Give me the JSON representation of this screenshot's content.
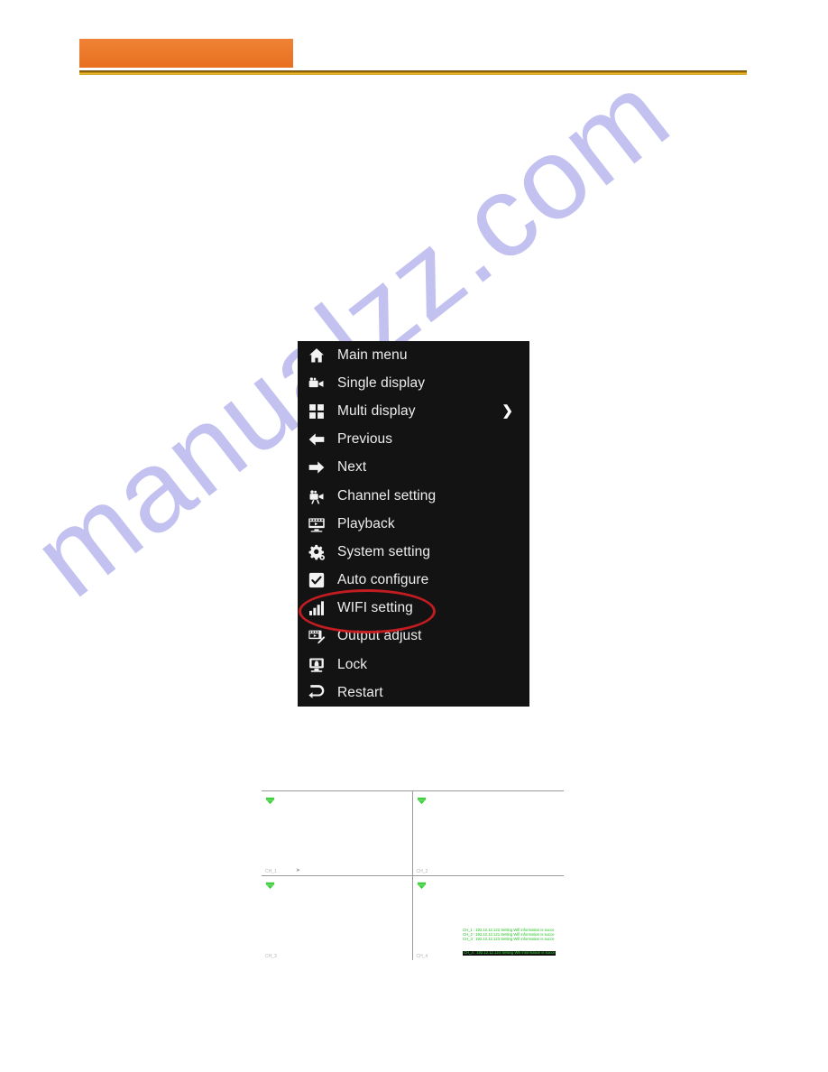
{
  "header": {
    "orange_band_color": "#ec7a2c",
    "rule_color": "#d9a114"
  },
  "watermark": {
    "text": "manualzz.com",
    "color": "#c3c1ef"
  },
  "context_menu": {
    "background_color": "#131313",
    "text_color": "#ededed",
    "items": [
      {
        "label": "Main menu",
        "icon": "home-icon",
        "submenu": false
      },
      {
        "label": "Single display",
        "icon": "video-camera-icon",
        "submenu": false
      },
      {
        "label": "Multi display",
        "icon": "grid-four-icon",
        "submenu": true,
        "arrow": "❯"
      },
      {
        "label": "Previous",
        "icon": "arrow-left-icon",
        "submenu": false
      },
      {
        "label": "Next",
        "icon": "arrow-right-icon",
        "submenu": false
      },
      {
        "label": "Channel setting",
        "icon": "camera-stand-icon",
        "submenu": false
      },
      {
        "label": "Playback",
        "icon": "film-playback-icon",
        "submenu": false
      },
      {
        "label": "System setting",
        "icon": "gears-icon",
        "submenu": false
      },
      {
        "label": "Auto configure",
        "icon": "checkbox-checked-icon",
        "submenu": false
      },
      {
        "label": "WIFI setting",
        "icon": "signal-bars-icon",
        "submenu": false,
        "highlighted": true
      },
      {
        "label": "Output adjust",
        "icon": "film-edit-icon",
        "submenu": false
      },
      {
        "label": "Lock",
        "icon": "monitor-lock-icon",
        "submenu": false
      },
      {
        "label": "Restart",
        "icon": "restart-arrow-icon",
        "submenu": false
      }
    ],
    "highlight": {
      "shape": "ellipse",
      "color": "#d01d22",
      "target_label": "WIFI setting"
    }
  },
  "dvr_screenshot": {
    "layout": "2x2",
    "panes": [
      {
        "label": "CH_1",
        "recording": true
      },
      {
        "label": "CH_2",
        "recording": true
      },
      {
        "label": "CH_3",
        "recording": true
      },
      {
        "label": "CH_4",
        "recording": true
      }
    ],
    "record_indicator_color": "#3fcf3f",
    "log_text_color": "#27c427",
    "log_lines": [
      {
        "text": "CH_1 : 192.12.12.122 Setting Wifi information is succe",
        "highlighted": false
      },
      {
        "text": "CH_2 : 192.12.12.121 Setting Wifi information is succe",
        "highlighted": false
      },
      {
        "text": "CH_3 : 192.12.12.123 Setting Wifi information is succe",
        "highlighted": false
      },
      {
        "text": "CH_4 : 192.12.12.124 Setting Wifi information is succe",
        "highlighted": true
      }
    ]
  }
}
